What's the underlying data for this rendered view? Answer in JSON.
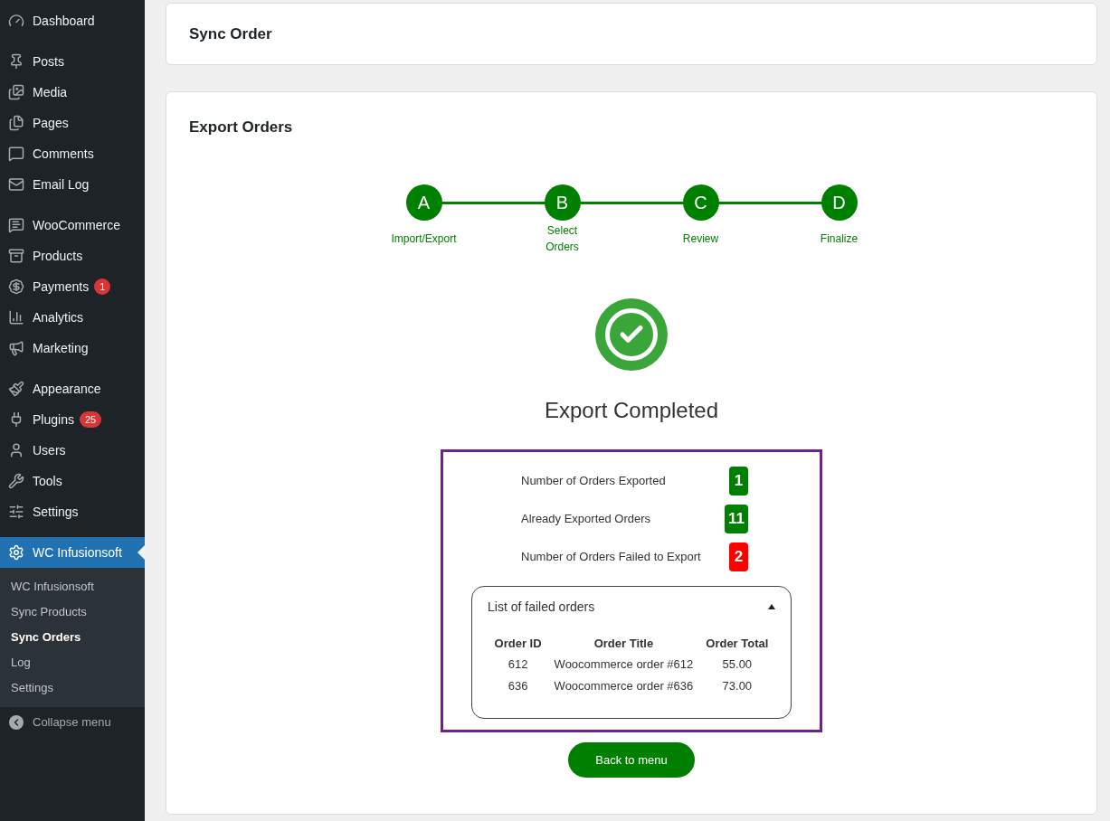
{
  "sidebar": {
    "groups": [
      [
        {
          "label": "Dashboard"
        }
      ],
      [
        {
          "label": "Posts"
        },
        {
          "label": "Media"
        },
        {
          "label": "Pages"
        },
        {
          "label": "Comments"
        },
        {
          "label": "Email Log"
        }
      ],
      [
        {
          "label": "WooCommerce"
        },
        {
          "label": "Products"
        },
        {
          "label": "Payments",
          "badge": "1"
        },
        {
          "label": "Analytics"
        },
        {
          "label": "Marketing"
        }
      ],
      [
        {
          "label": "Appearance"
        },
        {
          "label": "Plugins",
          "badge": "25"
        },
        {
          "label": "Users"
        },
        {
          "label": "Tools"
        },
        {
          "label": "Settings"
        }
      ]
    ],
    "current": {
      "label": "WC Infusionsoft",
      "submenu": [
        {
          "label": "WC Infusionsoft",
          "selected": false
        },
        {
          "label": "Sync Products",
          "selected": false
        },
        {
          "label": "Sync Orders",
          "selected": true
        },
        {
          "label": "Log",
          "selected": false
        },
        {
          "label": "Settings",
          "selected": false
        }
      ]
    },
    "collapse": "Collapse menu"
  },
  "header_card": {
    "title": "Sync Order"
  },
  "export_card": {
    "title": "Export Orders",
    "steps": [
      {
        "letter": "A",
        "label": "Import/Export"
      },
      {
        "letter": "B",
        "label": "Select Orders"
      },
      {
        "letter": "C",
        "label": "Review"
      },
      {
        "letter": "D",
        "label": "Finalize"
      }
    ],
    "status": "Export Completed",
    "stats": [
      {
        "label": "Number of Orders Exported",
        "value": "1",
        "color": "#008000"
      },
      {
        "label": "Already Exported Orders",
        "value": "11",
        "color": "#008000"
      },
      {
        "label": "Number of Orders Failed to Export",
        "value": "2",
        "color": "#ff0000"
      }
    ],
    "failed": {
      "title": "List of failed orders",
      "expanded": true,
      "columns": [
        "Order ID",
        "Order Title",
        "Order Total"
      ],
      "rows": [
        [
          "612",
          "Woocommerce order #612",
          "55.00"
        ],
        [
          "636",
          "Woocommerce order #636",
          "73.00"
        ]
      ]
    },
    "button": "Back to menu"
  }
}
